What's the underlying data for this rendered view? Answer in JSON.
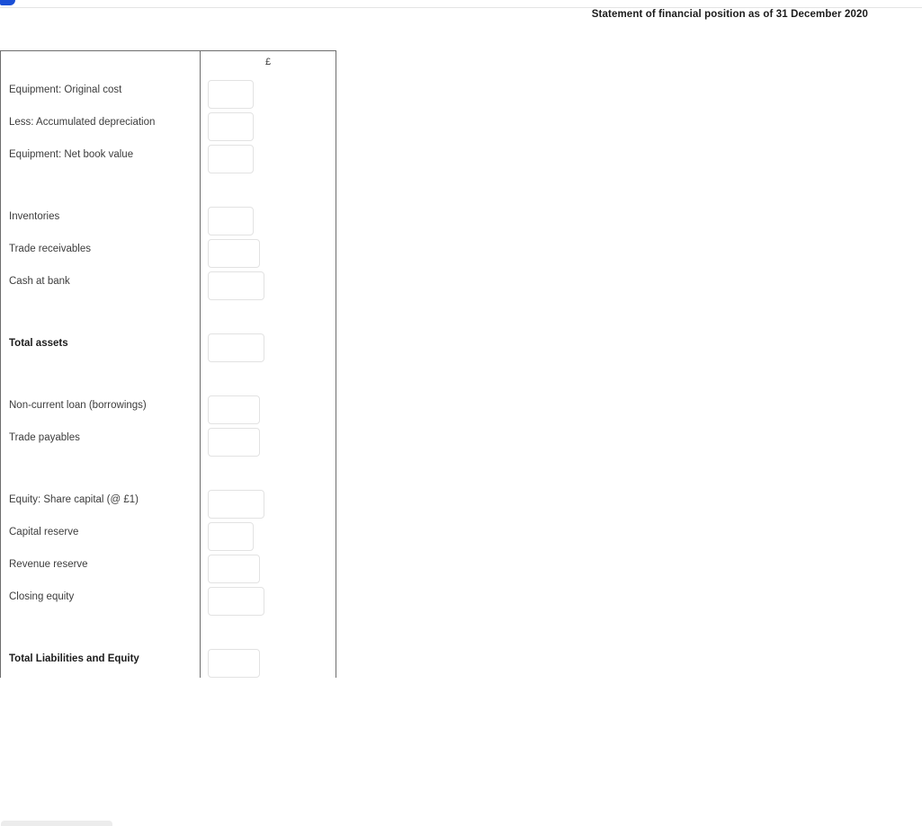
{
  "page": {
    "title": "Statement of financial position as of 31 December 2020",
    "accent_blue": "#1a4fd6",
    "border_color": "#6d6d6d",
    "input_border_color": "#e2e2e2",
    "text_color": "#3c3c3c"
  },
  "table": {
    "columns": {
      "label_header": "",
      "value_header": "£"
    },
    "rows": [
      {
        "type": "entry",
        "label": "Equipment: Original cost",
        "bold": false,
        "value": "",
        "box_size": "narrow"
      },
      {
        "type": "entry",
        "label": "Less: Accumulated depreciation",
        "bold": false,
        "value": "",
        "box_size": "narrow"
      },
      {
        "type": "entry",
        "label": "Equipment: Net book value",
        "bold": false,
        "value": "",
        "box_size": "narrow"
      },
      {
        "type": "spacer",
        "label": "",
        "bold": false,
        "value": "",
        "box_size": ""
      },
      {
        "type": "entry",
        "label": "Inventories",
        "bold": false,
        "value": "",
        "box_size": "narrow"
      },
      {
        "type": "entry",
        "label": "Trade receivables",
        "bold": false,
        "value": "",
        "box_size": "mid"
      },
      {
        "type": "entry",
        "label": "Cash at bank",
        "bold": false,
        "value": "",
        "box_size": "wide"
      },
      {
        "type": "spacer",
        "label": "",
        "bold": false,
        "value": "",
        "box_size": ""
      },
      {
        "type": "entry",
        "label": "Total assets",
        "bold": true,
        "value": "",
        "box_size": "wide"
      },
      {
        "type": "spacer",
        "label": "",
        "bold": false,
        "value": "",
        "box_size": ""
      },
      {
        "type": "entry",
        "label": "Non-current loan (borrowings)",
        "bold": false,
        "value": "",
        "box_size": "mid"
      },
      {
        "type": "entry",
        "label": "Trade payables",
        "bold": false,
        "value": "",
        "box_size": "mid"
      },
      {
        "type": "spacer",
        "label": "",
        "bold": false,
        "value": "",
        "box_size": ""
      },
      {
        "type": "entry",
        "label": "Equity: Share capital (@ £1)",
        "bold": false,
        "value": "",
        "box_size": "wide"
      },
      {
        "type": "entry",
        "label": "Capital reserve",
        "bold": false,
        "value": "",
        "box_size": "narrow"
      },
      {
        "type": "entry",
        "label": "Revenue reserve",
        "bold": false,
        "value": "",
        "box_size": "mid"
      },
      {
        "type": "entry",
        "label": "Closing equity",
        "bold": false,
        "value": "",
        "box_size": "wide"
      },
      {
        "type": "spacer",
        "label": "",
        "bold": false,
        "value": "",
        "box_size": ""
      },
      {
        "type": "entry",
        "label": "Total Liabilities and Equity",
        "bold": true,
        "value": "",
        "box_size": "mid"
      }
    ]
  }
}
